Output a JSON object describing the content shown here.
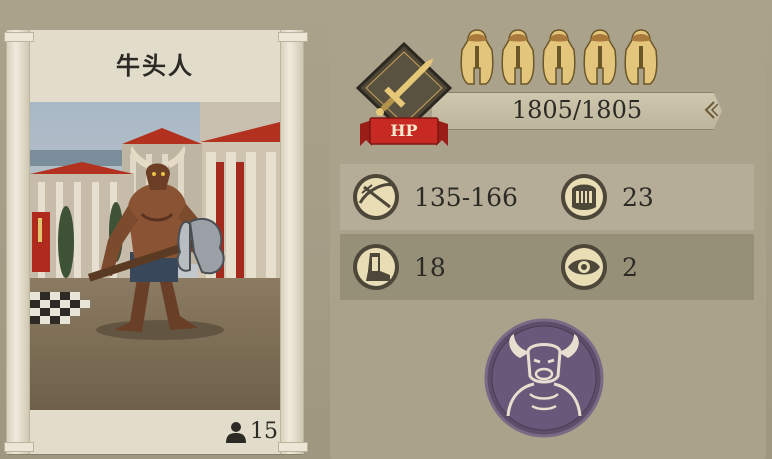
{
  "unit": {
    "name": "牛头人",
    "count": "15"
  },
  "stats": {
    "hp_label": "HP",
    "hp": "1805/1805",
    "damage": "135-166",
    "defense": "23",
    "speed": "18",
    "initiative": "2"
  },
  "rank": {
    "stars": 5
  },
  "colors": {
    "hp_ribbon": "#c62a23",
    "gold": "#e6c878",
    "emblem": "#5d4d6a"
  },
  "icons": {
    "rank": "spartan-helmet-icon",
    "attack_type": "sword-icon",
    "damage": "crossbow-icon",
    "defense": "armor-icon",
    "speed": "boot-icon",
    "initiative": "eye-icon",
    "faction": "minotaur-emblem-icon",
    "unit_count": "person-icon"
  }
}
